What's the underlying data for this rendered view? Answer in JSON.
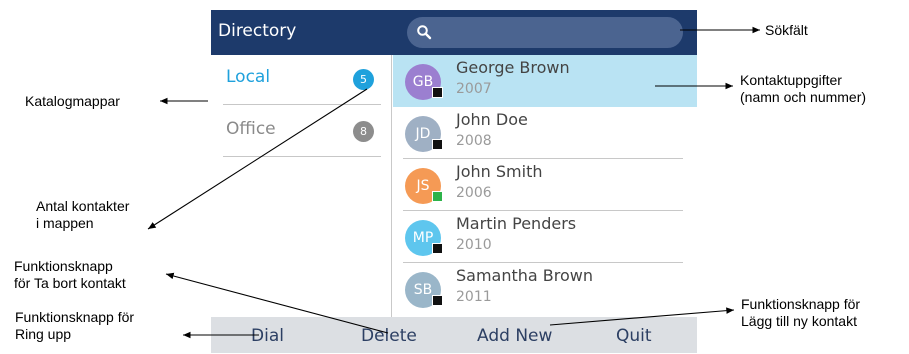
{
  "header": {
    "title": "Directory",
    "search_placeholder": ""
  },
  "folders": [
    {
      "label": "Local",
      "count": "5",
      "active": true
    },
    {
      "label": "Office",
      "count": "8",
      "active": false
    }
  ],
  "contacts": [
    {
      "initials": "GB",
      "name": "George Brown",
      "number": "2007",
      "avatar_color": "#9b7fd0",
      "presence_color": "#111111",
      "selected": true
    },
    {
      "initials": "JD",
      "name": "John Doe",
      "number": "2008",
      "avatar_color": "#9fb0c4",
      "presence_color": "#111111",
      "selected": false
    },
    {
      "initials": "JS",
      "name": "John Smith",
      "number": "2006",
      "avatar_color": "#f59a55",
      "presence_color": "#2db34a",
      "selected": false
    },
    {
      "initials": "MP",
      "name": "Martin Penders",
      "number": "2010",
      "avatar_color": "#5ec6ee",
      "presence_color": "#111111",
      "selected": false
    },
    {
      "initials": "SB",
      "name": "Samantha Brown",
      "number": "2011",
      "avatar_color": "#9ab6c9",
      "presence_color": "#111111",
      "selected": false
    }
  ],
  "softkeys": {
    "dial": "Dial",
    "delete": "Delete",
    "add_new": "Add New",
    "quit": "Quit"
  },
  "callouts": {
    "search": "Sökfält",
    "contact_details_1": "Kontaktuppgifter",
    "contact_details_2": "(namn och nummer)",
    "folders": "Katalogmappar",
    "count_1": "Antal kontakter",
    "count_2": "i mappen",
    "delete_1": "Funktionsknapp",
    "delete_2": "för Ta bort kontakt",
    "dial_1": "Funktionsknapp för",
    "dial_2": "Ring upp",
    "add_1": "Funktionsknapp för",
    "add_2": "Lägg till ny kontakt"
  },
  "colors": {
    "titlebar": "#1d3a6b",
    "active_folder": "#1fa1dc",
    "inactive_folder": "#8a8a8a",
    "active_badge": "#1fa1dc",
    "inactive_badge": "#8d8d8d",
    "selection": "#b9e3f3"
  }
}
